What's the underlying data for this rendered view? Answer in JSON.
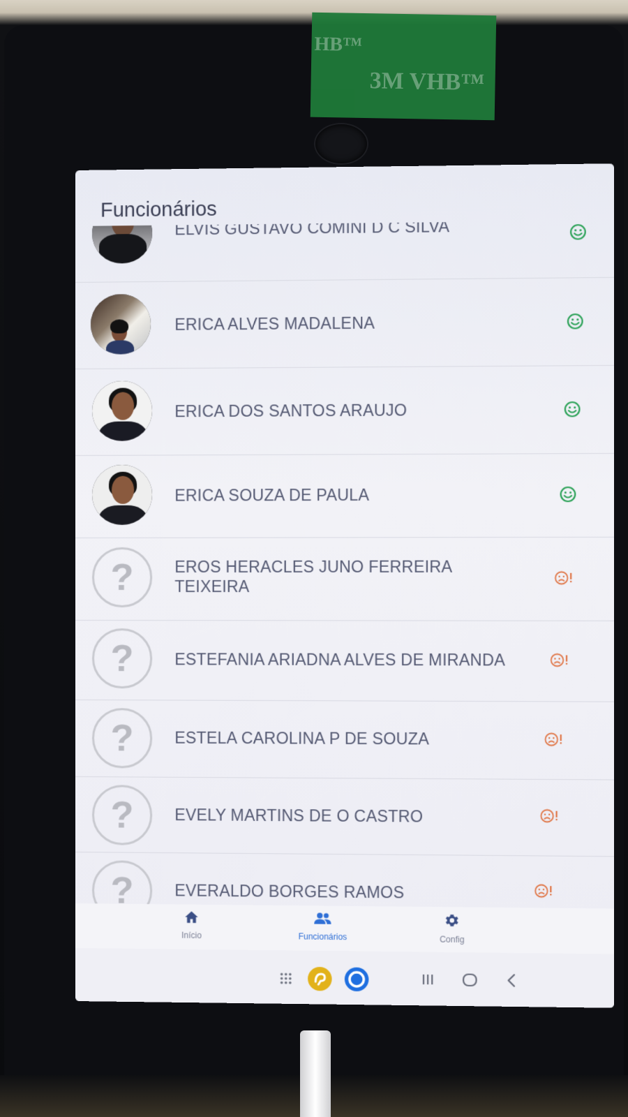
{
  "header": {
    "title": "Funcionários"
  },
  "employees": [
    {
      "name": "ELVIS GUSTAVO COMINI D C SILVA",
      "avatar": "photo",
      "status": "ok",
      "status_icon": "smile-icon"
    },
    {
      "name": "ERICA ALVES MADALENA",
      "avatar": "photo",
      "status": "ok",
      "status_icon": "smile-icon"
    },
    {
      "name": "ERICA DOS SANTOS ARAUJO",
      "avatar": "photo",
      "status": "ok",
      "status_icon": "smile-icon"
    },
    {
      "name": "ERICA SOUZA DE PAULA",
      "avatar": "photo",
      "status": "ok",
      "status_icon": "smile-icon"
    },
    {
      "name": "EROS HERACLES JUNO FERREIRA TEIXEIRA",
      "name_line1": "EROS HERACLES JUNO FERREIRA",
      "name_line2": "TEIXEIRA",
      "avatar": "unknown",
      "status": "pending",
      "status_icon": "sad-alert-icon"
    },
    {
      "name": "ESTEFANIA ARIADNA ALVES DE MIRANDA",
      "avatar": "unknown",
      "status": "pending",
      "status_icon": "sad-alert-icon"
    },
    {
      "name": "ESTELA CAROLINA P DE SOUZA",
      "avatar": "unknown",
      "status": "pending",
      "status_icon": "sad-alert-icon"
    },
    {
      "name": "EVELY MARTINS DE O CASTRO",
      "avatar": "unknown",
      "status": "pending",
      "status_icon": "sad-alert-icon"
    },
    {
      "name": "EVERALDO BORGES RAMOS",
      "avatar": "unknown",
      "status": "pending",
      "status_icon": "sad-alert-icon"
    }
  ],
  "unknown_avatar_glyph": "?",
  "nav": {
    "items": [
      {
        "label": "Início",
        "icon": "home-icon",
        "active": false
      },
      {
        "label": "Funcionários",
        "icon": "people-icon",
        "active": true
      },
      {
        "label": "Config",
        "icon": "gear-icon",
        "active": false
      }
    ]
  },
  "colors": {
    "ok": "#2fa35a",
    "pending": "#e0784a",
    "nav_active": "#2f6fd6",
    "nav_inactive": "#7c8196",
    "nav_home_icon": "#3b4f86"
  },
  "system_bar": {
    "icons": [
      "apps-grid-icon",
      "app-shortcut-icon",
      "camera-app-icon",
      "recents-icon",
      "home-circle-icon",
      "back-icon"
    ]
  },
  "tape": {
    "text_top": "HB™",
    "text_bottom": "3M VHB™"
  }
}
